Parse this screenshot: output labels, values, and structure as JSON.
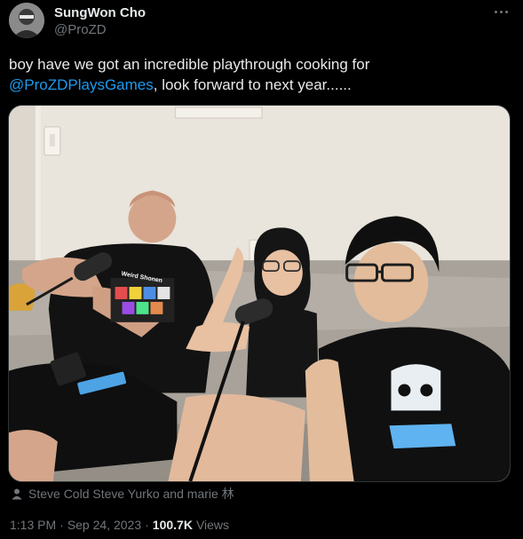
{
  "author": {
    "name": "SungWon Cho",
    "handle": "@ProZD"
  },
  "tweet": {
    "text_before": "boy have we got an incredible playthrough cooking for",
    "mention": "@ProZDPlaysGames",
    "text_after": ", look forward to next year......"
  },
  "media": {
    "shirt_text": "Weird Shonen",
    "icons": {
      "more": "more-dots-icon",
      "tag": "person-tag-icon"
    }
  },
  "tagged": {
    "text": "Steve Cold Steve Yurko and marie 林"
  },
  "meta": {
    "time": "1:13 PM",
    "separator1": "·",
    "date": "Sep 24, 2023",
    "separator2": "·",
    "views_count": "100.7K",
    "views_label": "Views"
  },
  "colors": {
    "background": "#000000",
    "text": "#e7e9ea",
    "muted": "#71767b",
    "link": "#1d9bf0"
  }
}
